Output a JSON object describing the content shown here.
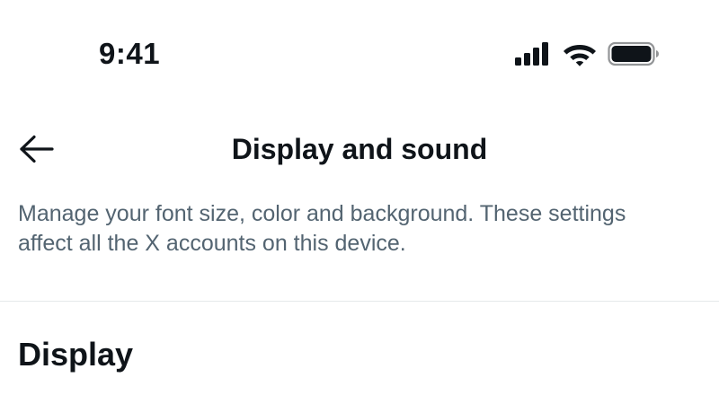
{
  "status_bar": {
    "time": "9:41",
    "icons": [
      "signal-icon",
      "wifi-icon",
      "battery-icon"
    ]
  },
  "header": {
    "back_icon": "arrow-left-icon",
    "title": "Display and sound"
  },
  "description": "Manage your font size, color and background. These settings affect all the X accounts on this device.",
  "section": {
    "title": "Display"
  },
  "colors": {
    "text_primary": "#0f1419",
    "text_secondary": "#536471",
    "divider": "#e6e9eb",
    "background": "#ffffff"
  }
}
